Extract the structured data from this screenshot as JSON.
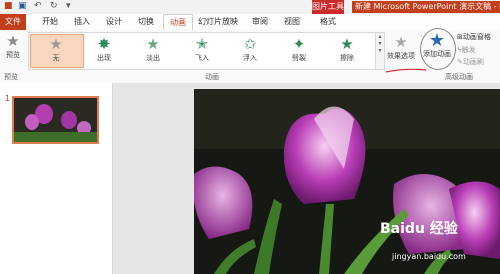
{
  "titlebar": {
    "context_label": "图片工具",
    "title": "新建 Microsoft PowerPoint 演示文稿 - Powe"
  },
  "tabs": [
    {
      "label": "文件"
    },
    {
      "label": "开始"
    },
    {
      "label": "插入"
    },
    {
      "label": "设计"
    },
    {
      "label": "切换"
    },
    {
      "label": "动画"
    },
    {
      "label": "幻灯片放映"
    },
    {
      "label": "审阅"
    },
    {
      "label": "视图"
    },
    {
      "label": "格式"
    }
  ],
  "ribbon": {
    "preview": {
      "label": "预览",
      "group": "预览"
    },
    "animations": [
      {
        "label": "无",
        "icon": "star-icon"
      },
      {
        "label": "出现",
        "icon": "star-burst-icon"
      },
      {
        "label": "淡出",
        "icon": "star-icon"
      },
      {
        "label": "飞入",
        "icon": "star-fly-icon"
      },
      {
        "label": "浮入",
        "icon": "star-float-icon"
      },
      {
        "label": "劈裂",
        "icon": "star-split-icon"
      },
      {
        "label": "擦除",
        "icon": "star-wipe-icon"
      }
    ],
    "animation_group_label": "动画",
    "effect_options": {
      "label": "效果选项"
    },
    "add_animation": {
      "label": "添加动画"
    },
    "animation_pane": {
      "label": "动画窗格"
    },
    "trigger": {
      "label": "触发"
    },
    "animation_painter": {
      "label": "动画刷"
    },
    "advanced_group_label": "高级动画"
  },
  "slides": [
    {
      "number": "1"
    }
  ],
  "watermark": {
    "brand": "Baidu 经验",
    "url": "jingyan.baidu.com"
  },
  "colors": {
    "accent": "#c43e1c",
    "context_tab": "#cc2a2a",
    "selected_animation": "#f9d7bf"
  }
}
